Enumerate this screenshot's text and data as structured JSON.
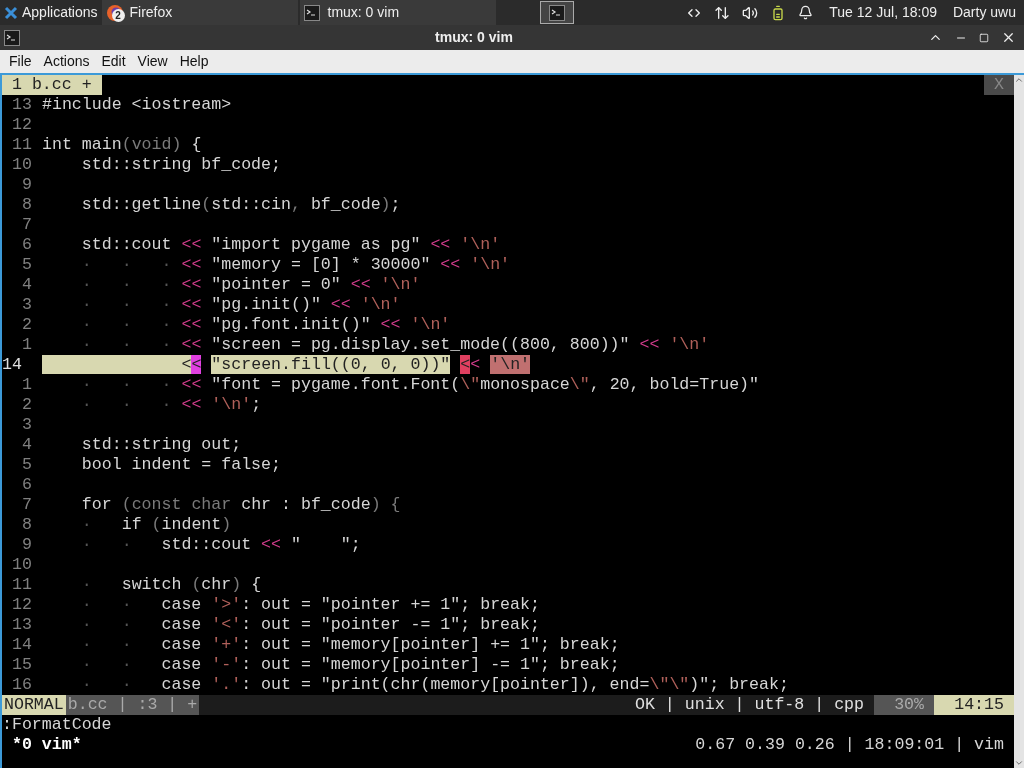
{
  "taskbar": {
    "items": [
      {
        "kind": "menu",
        "label": "Applications"
      },
      {
        "kind": "browser",
        "label": "Firefox",
        "badge": "2"
      },
      {
        "kind": "window",
        "label": "tmux: 0 vim"
      }
    ],
    "clock": "Tue 12 Jul, 18:09",
    "user": "Darty uwu"
  },
  "window": {
    "title": "tmux: 0 vim"
  },
  "menu": [
    "File",
    "Actions",
    "Edit",
    "View",
    "Help"
  ],
  "vim": {
    "tabs": [
      {
        "label": "1 b.cc +",
        "selected": true
      }
    ],
    "close_label": "X",
    "lines": [
      {
        "number": "13",
        "current": false,
        "segments": [
          {
            "kind": "plain",
            "text": "#include <iostream>"
          }
        ]
      },
      {
        "number": "12",
        "current": false
      },
      {
        "number": "11",
        "current": false,
        "segments": [
          {
            "kind": "plain",
            "text": "int main"
          },
          {
            "kind": "dim",
            "text": "(void)"
          },
          {
            "kind": "plain",
            "text": " {"
          }
        ]
      },
      {
        "number": "10",
        "current": false,
        "segments": [
          {
            "kind": "plain",
            "text": "    std::string bf_code;"
          }
        ]
      },
      {
        "number": "9",
        "current": false
      },
      {
        "number": "8",
        "current": false,
        "segments": [
          {
            "kind": "plain",
            "text": "    std::getline"
          },
          {
            "kind": "dim",
            "text": "("
          },
          {
            "kind": "plain",
            "text": "std::cin"
          },
          {
            "kind": "dim",
            "text": ", "
          },
          {
            "kind": "plain",
            "text": "bf_code"
          },
          {
            "kind": "dim",
            "text": ")"
          },
          {
            "kind": "plain",
            "text": ";"
          }
        ]
      },
      {
        "number": "7",
        "current": false
      },
      {
        "number": "6",
        "current": false,
        "segments": [
          {
            "kind": "plain",
            "text": "    std::cout "
          },
          {
            "kind": "op",
            "text": "<<"
          },
          {
            "kind": "string",
            "text": " \"import pygame as pg\" "
          },
          {
            "kind": "op",
            "text": "<<"
          },
          {
            "kind": "char",
            "text": " '\\n'"
          }
        ]
      },
      {
        "number": "5",
        "current": false,
        "segments": [
          {
            "kind": "tab",
            "text": "    ·   ·   · "
          },
          {
            "kind": "op",
            "text": "<<"
          },
          {
            "kind": "string",
            "text": " \"memory = [0] * 30000\" "
          },
          {
            "kind": "op",
            "text": "<<"
          },
          {
            "kind": "char",
            "text": " '\\n'"
          }
        ]
      },
      {
        "number": "4",
        "current": false,
        "segments": [
          {
            "kind": "tab",
            "text": "    ·   ·   · "
          },
          {
            "kind": "op",
            "text": "<<"
          },
          {
            "kind": "string",
            "text": " \"pointer = 0\" "
          },
          {
            "kind": "op",
            "text": "<<"
          },
          {
            "kind": "char",
            "text": " '\\n'"
          }
        ]
      },
      {
        "number": "3",
        "current": false,
        "segments": [
          {
            "kind": "tab",
            "text": "    ·   ·   · "
          },
          {
            "kind": "op",
            "text": "<<"
          },
          {
            "kind": "string",
            "text": " \"pg.init()\" "
          },
          {
            "kind": "op",
            "text": "<<"
          },
          {
            "kind": "char",
            "text": " '\\n'"
          }
        ]
      },
      {
        "number": "2",
        "current": false,
        "segments": [
          {
            "kind": "tab",
            "text": "    ·   ·   · "
          },
          {
            "kind": "op",
            "text": "<<"
          },
          {
            "kind": "string",
            "text": " \"pg.font.init()\" "
          },
          {
            "kind": "op",
            "text": "<<"
          },
          {
            "kind": "char",
            "text": " '\\n'"
          }
        ]
      },
      {
        "number": "1",
        "current": false,
        "segments": [
          {
            "kind": "tab",
            "text": "    ·   ·   · "
          },
          {
            "kind": "op",
            "text": "<<"
          },
          {
            "kind": "string",
            "text": " \"screen = pg.display.set_mode((800, 800))\" "
          },
          {
            "kind": "op",
            "text": "<<"
          },
          {
            "kind": "char",
            "text": " '\\n'"
          }
        ]
      },
      {
        "number": "14",
        "current": true,
        "segments": [
          {
            "kind": "hl",
            "text": "              <"
          },
          {
            "kind": "hl-mark",
            "text": "<"
          },
          {
            "kind": "hl",
            "text": "\"screen.fill((0, 0, 0))\"",
            "gap_before": true
          },
          {
            "kind": "hl-err",
            "text": "<",
            "gap_before": true
          },
          {
            "kind": "op",
            "text": "< "
          },
          {
            "kind": "hl-char",
            "text": "'\\n'"
          }
        ]
      },
      {
        "number": "1",
        "current": false,
        "segments": [
          {
            "kind": "tab",
            "text": "    ·   ·   · "
          },
          {
            "kind": "op",
            "text": "<<"
          },
          {
            "kind": "string",
            "text": " \"font = pygame.font.Font("
          },
          {
            "kind": "char",
            "text": "\\\""
          },
          {
            "kind": "string",
            "text": "monospace"
          },
          {
            "kind": "char",
            "text": "\\\""
          },
          {
            "kind": "string",
            "text": ", 20, bold=True)\""
          }
        ]
      },
      {
        "number": "2",
        "current": false,
        "segments": [
          {
            "kind": "tab",
            "text": "    ·   ·   · "
          },
          {
            "kind": "op",
            "text": "<<"
          },
          {
            "kind": "char",
            "text": " '\\n'"
          },
          {
            "kind": "plain",
            "text": ";"
          }
        ]
      },
      {
        "number": "3",
        "current": false
      },
      {
        "number": "4",
        "current": false,
        "segments": [
          {
            "kind": "plain",
            "text": "    std::string out;"
          }
        ]
      },
      {
        "number": "5",
        "current": false,
        "segments": [
          {
            "kind": "plain",
            "text": "    bool indent = false;"
          }
        ]
      },
      {
        "number": "6",
        "current": false
      },
      {
        "number": "7",
        "current": false,
        "segments": [
          {
            "kind": "plain",
            "text": "    for "
          },
          {
            "kind": "dim",
            "text": "(const char"
          },
          {
            "kind": "plain",
            "text": " chr : bf_code"
          },
          {
            "kind": "dim",
            "text": ") {"
          }
        ]
      },
      {
        "number": "8",
        "current": false,
        "segments": [
          {
            "kind": "tab",
            "text": "    ·   "
          },
          {
            "kind": "plain",
            "text": "if "
          },
          {
            "kind": "dim",
            "text": "("
          },
          {
            "kind": "plain",
            "text": "indent"
          },
          {
            "kind": "dim",
            "text": ")"
          }
        ]
      },
      {
        "number": "9",
        "current": false,
        "segments": [
          {
            "kind": "tab",
            "text": "    ·   ·   "
          },
          {
            "kind": "plain",
            "text": "std::cout "
          },
          {
            "kind": "op",
            "text": "<<"
          },
          {
            "kind": "string",
            "text": " \"    \";"
          }
        ]
      },
      {
        "number": "10",
        "current": false
      },
      {
        "number": "11",
        "current": false,
        "segments": [
          {
            "kind": "tab",
            "text": "    ·   "
          },
          {
            "kind": "plain",
            "text": "switch "
          },
          {
            "kind": "dim",
            "text": "("
          },
          {
            "kind": "plain",
            "text": "chr"
          },
          {
            "kind": "dim",
            "text": ")"
          },
          {
            "kind": "plain",
            "text": " {"
          }
        ]
      },
      {
        "number": "12",
        "current": false,
        "segments": [
          {
            "kind": "tab",
            "text": "    ·   ·   "
          },
          {
            "kind": "plain",
            "text": "case "
          },
          {
            "kind": "char",
            "text": "'>'"
          },
          {
            "kind": "plain",
            "text": ": out = "
          },
          {
            "kind": "string",
            "text": "\"pointer += 1\""
          },
          {
            "kind": "plain",
            "text": "; break;"
          }
        ]
      },
      {
        "number": "13",
        "current": false,
        "segments": [
          {
            "kind": "tab",
            "text": "    ·   ·   "
          },
          {
            "kind": "plain",
            "text": "case "
          },
          {
            "kind": "char",
            "text": "'<'"
          },
          {
            "kind": "plain",
            "text": ": out = "
          },
          {
            "kind": "string",
            "text": "\"pointer -= 1\""
          },
          {
            "kind": "plain",
            "text": "; break;"
          }
        ]
      },
      {
        "number": "14",
        "current": false,
        "segments": [
          {
            "kind": "tab",
            "text": "    ·   ·   "
          },
          {
            "kind": "plain",
            "text": "case "
          },
          {
            "kind": "char",
            "text": "'+'"
          },
          {
            "kind": "plain",
            "text": ": out = "
          },
          {
            "kind": "string",
            "text": "\"memory[pointer] += 1\""
          },
          {
            "kind": "plain",
            "text": "; break;"
          }
        ]
      },
      {
        "number": "15",
        "current": false,
        "segments": [
          {
            "kind": "tab",
            "text": "    ·   ·   "
          },
          {
            "kind": "plain",
            "text": "case "
          },
          {
            "kind": "char",
            "text": "'-'"
          },
          {
            "kind": "plain",
            "text": ": out = "
          },
          {
            "kind": "string",
            "text": "\"memory[pointer] -= 1\""
          },
          {
            "kind": "plain",
            "text": "; break;"
          }
        ]
      },
      {
        "number": "16",
        "current": false,
        "segments": [
          {
            "kind": "tab",
            "text": "    ·   ·   "
          },
          {
            "kind": "plain",
            "text": "case "
          },
          {
            "kind": "char",
            "text": "'.'"
          },
          {
            "kind": "plain",
            "text": ": out = "
          },
          {
            "kind": "string",
            "text": "\"print(chr(memory[pointer]), end="
          },
          {
            "kind": "char",
            "text": "\\\"\\\""
          },
          {
            "kind": "string",
            "text": ")\""
          },
          {
            "kind": "plain",
            "text": "; break;"
          }
        ]
      }
    ],
    "statusline": {
      "mode": "NORMAL",
      "file_info": "b.cc | :3 | +",
      "info": "OK | unix | utf-8 | cpp",
      "percent": "30%",
      "position": "14:15"
    },
    "command": ":FormatCode"
  },
  "tmux": {
    "window": "*0 vim*",
    "status": "0.67 0.39 0.26 | 18:09:01 | vim"
  }
}
